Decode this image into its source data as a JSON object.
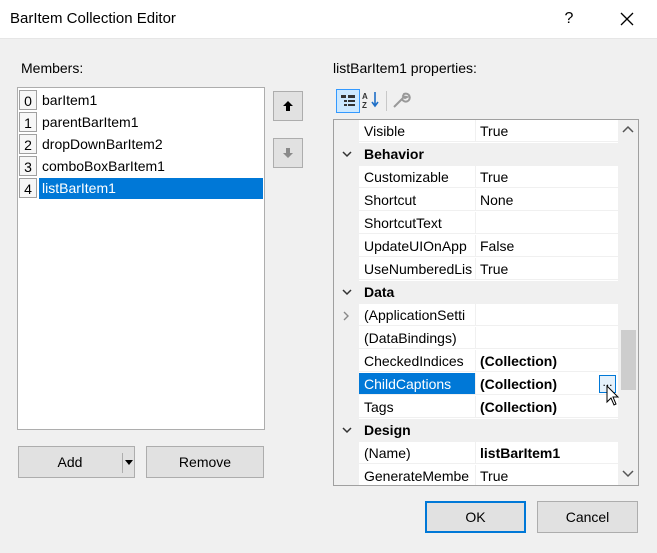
{
  "window": {
    "title": "BarItem Collection Editor",
    "help_label": "?"
  },
  "members": {
    "label": "Members:",
    "items": [
      {
        "index": "0",
        "name": "barItem1"
      },
      {
        "index": "1",
        "name": "parentBarItem1"
      },
      {
        "index": "2",
        "name": "dropDownBarItem2"
      },
      {
        "index": "3",
        "name": "comboBoxBarItem1"
      },
      {
        "index": "4",
        "name": "listBarItem1"
      }
    ],
    "selected_index": 4
  },
  "buttons": {
    "add": "Add",
    "remove": "Remove",
    "ok": "OK",
    "cancel": "Cancel"
  },
  "properties": {
    "label": "listBarItem1 properties:",
    "toolbar": {
      "active": "categorized"
    },
    "rows": {
      "visible": {
        "name": "Visible",
        "value": "True"
      },
      "behavior": {
        "name": "Behavior"
      },
      "customizable": {
        "name": "Customizable",
        "value": "True"
      },
      "shortcut": {
        "name": "Shortcut",
        "value": "None"
      },
      "shortcuttext": {
        "name": "ShortcutText",
        "value": ""
      },
      "updateui": {
        "name": "UpdateUIOnApp",
        "value": "False"
      },
      "usenumbered": {
        "name": "UseNumberedLis",
        "value": "True"
      },
      "data": {
        "name": "Data"
      },
      "appsettings": {
        "name": "(ApplicationSetti",
        "value": ""
      },
      "databindings": {
        "name": "(DataBindings)",
        "value": ""
      },
      "checkedindices": {
        "name": "CheckedIndices",
        "value": "(Collection)"
      },
      "childcaptions": {
        "name": "ChildCaptions",
        "value": "(Collection)",
        "ellipsis": "..."
      },
      "tags": {
        "name": "Tags",
        "value": "(Collection)"
      },
      "design": {
        "name": "Design"
      },
      "name": {
        "name": "(Name)",
        "value": "listBarItem1"
      },
      "generatemember": {
        "name": "GenerateMembe",
        "value": "True"
      }
    }
  },
  "colors": {
    "selection": "#0078d7",
    "category_bg": "#f0f0f0"
  }
}
